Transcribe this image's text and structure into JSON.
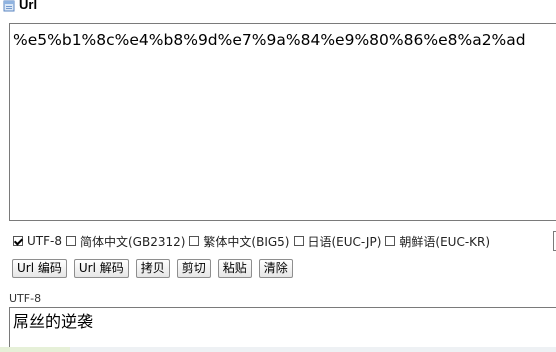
{
  "header": {
    "title": "Url",
    "icon": "document-icon"
  },
  "output": {
    "value": "%e5%b1%8c%e4%b8%9d%e7%9a%84%e9%80%86%e8%a2%ad"
  },
  "charsets": [
    {
      "label": "UTF-8",
      "checked": true
    },
    {
      "label": "简体中文(GB2312)",
      "checked": false
    },
    {
      "label": "繁体中文(BIG5)",
      "checked": false
    },
    {
      "label": "日语(EUC-JP)",
      "checked": false
    },
    {
      "label": "朝鲜语(EUC-KR)",
      "checked": false
    }
  ],
  "buttons": {
    "encode": "Url 编码",
    "decode": "Url 解码",
    "copy": "拷贝",
    "cut": "剪切",
    "paste": "粘贴",
    "clear": "清除"
  },
  "input": {
    "charset_label": "UTF-8",
    "value": "屌丝的逆袭"
  }
}
